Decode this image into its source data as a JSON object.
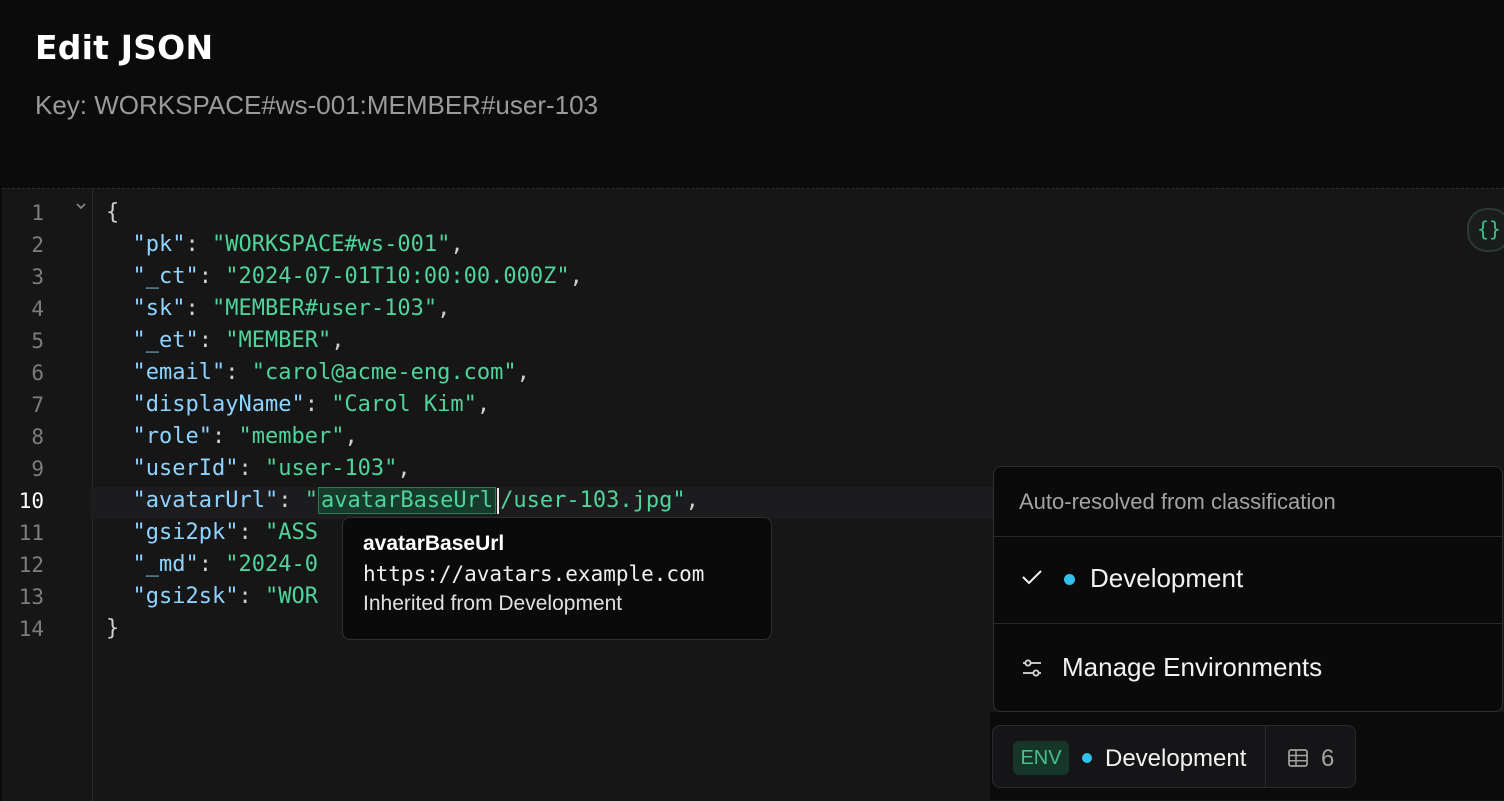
{
  "header": {
    "title": "Edit JSON",
    "subtitle": "Key: WORKSPACE#ws-001:MEMBER#user-103"
  },
  "editor": {
    "line_numbers": [
      "1",
      "2",
      "3",
      "4",
      "5",
      "6",
      "7",
      "8",
      "9",
      "10",
      "11",
      "12",
      "13",
      "14"
    ],
    "active_line": "10",
    "lines": [
      {
        "punct_before": "{"
      },
      {
        "key": "\"pk\"",
        "sep": ": ",
        "value": "\"WORKSPACE#ws-001\"",
        "tail": ","
      },
      {
        "key": "\"_ct\"",
        "sep": ": ",
        "value": "\"2024-07-01T10:00:00.000Z\"",
        "tail": ","
      },
      {
        "key": "\"sk\"",
        "sep": ": ",
        "value": "\"MEMBER#user-103\"",
        "tail": ","
      },
      {
        "key": "\"_et\"",
        "sep": ": ",
        "value": "\"MEMBER\"",
        "tail": ","
      },
      {
        "key": "\"email\"",
        "sep": ": ",
        "value": "\"carol@acme-eng.com\"",
        "tail": ","
      },
      {
        "key": "\"displayName\"",
        "sep": ": ",
        "value": "\"Carol Kim\"",
        "tail": ","
      },
      {
        "key": "\"role\"",
        "sep": ": ",
        "value": "\"member\"",
        "tail": ","
      },
      {
        "key": "\"userId\"",
        "sep": ": ",
        "value": "\"user-103\"",
        "tail": ","
      },
      {
        "key": "\"avatarUrl\"",
        "sep": ": ",
        "value_open": "\"",
        "variable": "avatarBaseUrl",
        "value_rest": "/user-103.jpg\"",
        "tail": ","
      },
      {
        "key": "\"gsi2pk\"",
        "sep": ": ",
        "value": "\"ASS"
      },
      {
        "key": "\"_md\"",
        "sep": ": ",
        "value": "\"2024-0"
      },
      {
        "key": "\"gsi2sk\"",
        "sep": ": ",
        "value": "\"WOR"
      },
      {
        "punct_before": "}"
      }
    ]
  },
  "format_button": {
    "icon": "curly-braces-icon",
    "glyph": "{}"
  },
  "tooltip": {
    "name": "avatarBaseUrl",
    "value": "https://avatars.example.com",
    "note": "Inherited from Development"
  },
  "env_dropdown": {
    "header": "Auto-resolved from classification",
    "selected_label": "Development",
    "manage_label": "Manage Environments"
  },
  "env_bar": {
    "badge": "ENV",
    "current": "Development",
    "count": "6"
  },
  "colors": {
    "accent_green": "#4fd49a",
    "key_blue": "#8fd3ff",
    "env_dot": "#2fc0ec"
  }
}
